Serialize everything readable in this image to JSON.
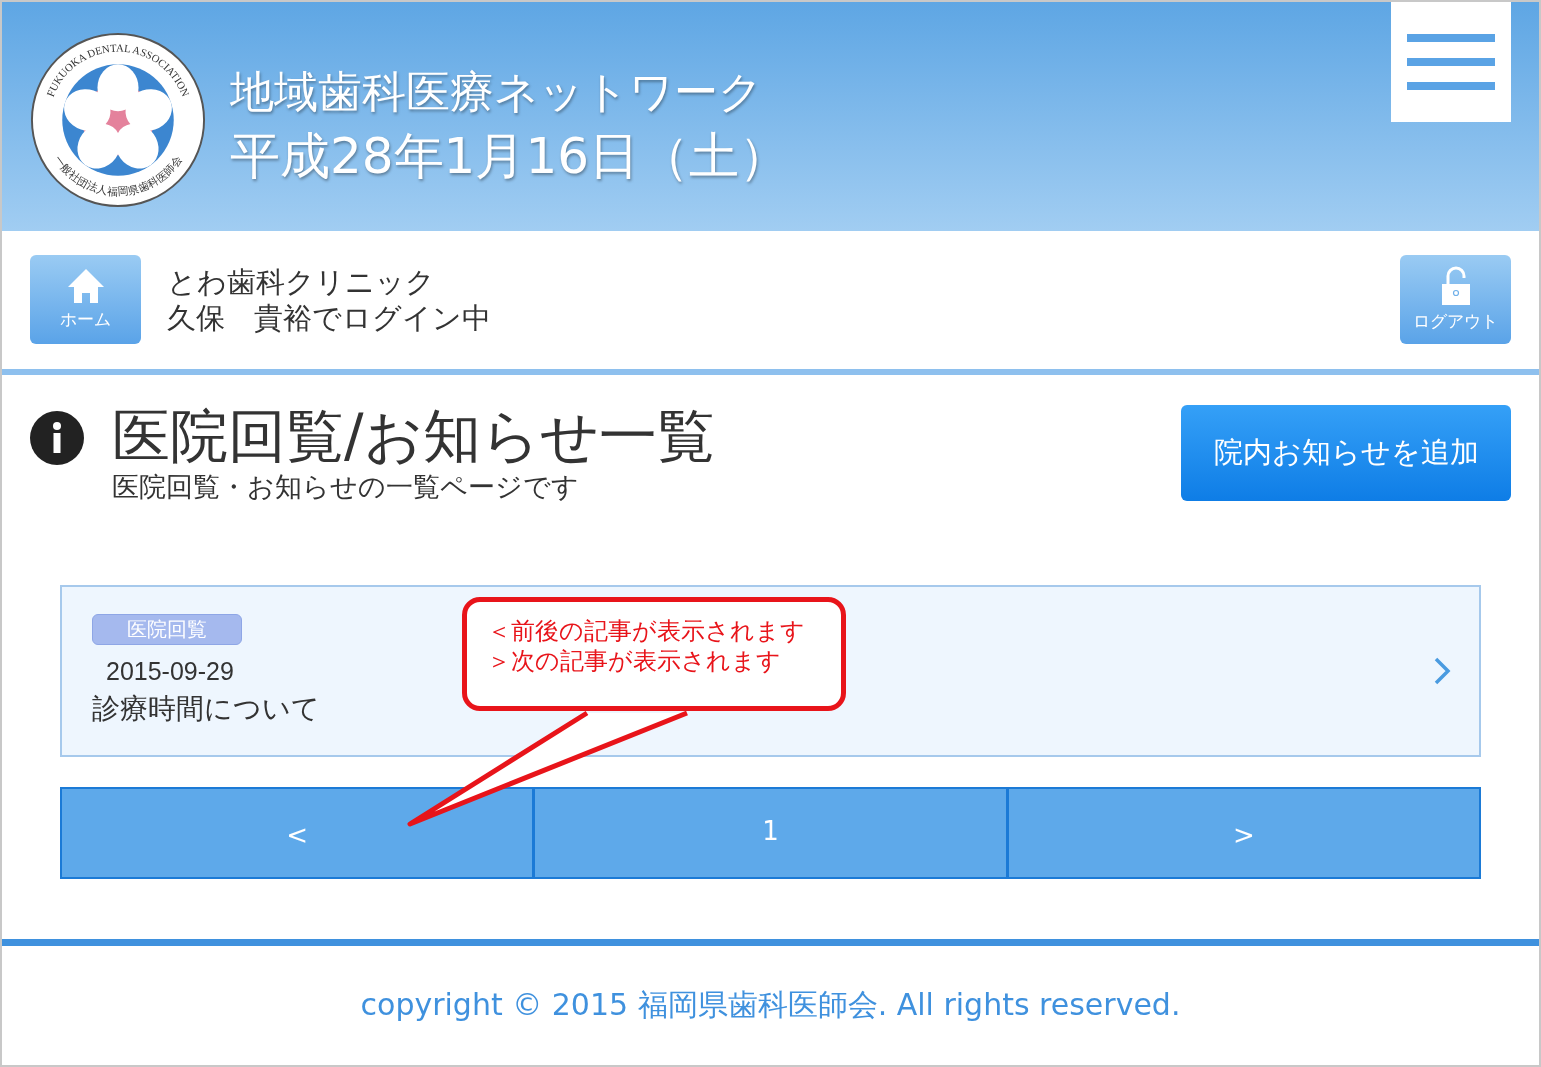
{
  "header": {
    "logo": {
      "text_en": "FUKUOKA DENTAL ASSOCIATION",
      "text_ja": "一般社団法人福岡県歯科医師会"
    },
    "title": "地域歯科医療ネットワーク",
    "date": "平成28年1月16日（土）"
  },
  "user_bar": {
    "home_label": "ホーム",
    "clinic": "とわ歯科クリニック",
    "login_status": "久保　貴裕でログイン中",
    "logout_label": "ログアウト"
  },
  "page": {
    "title": "医院回覧/お知らせ一覧",
    "subtitle": "医院回覧・お知らせの一覧ページです",
    "add_button": "院内お知らせを追加"
  },
  "notices": [
    {
      "tag": "医院回覧",
      "date": "2015-09-29",
      "title": "診療時間について"
    }
  ],
  "pager": [
    {
      "label": "<",
      "kind": "prev"
    },
    {
      "label": "1",
      "kind": "page"
    },
    {
      "label": ">",
      "kind": "next"
    }
  ],
  "callout": {
    "lines": [
      "＜前後の記事が表示されます",
      "＞次の記事が表示されます"
    ]
  },
  "footer": {
    "copyright": "copyright © 2015 福岡県歯科医師会. All rights reserved."
  }
}
